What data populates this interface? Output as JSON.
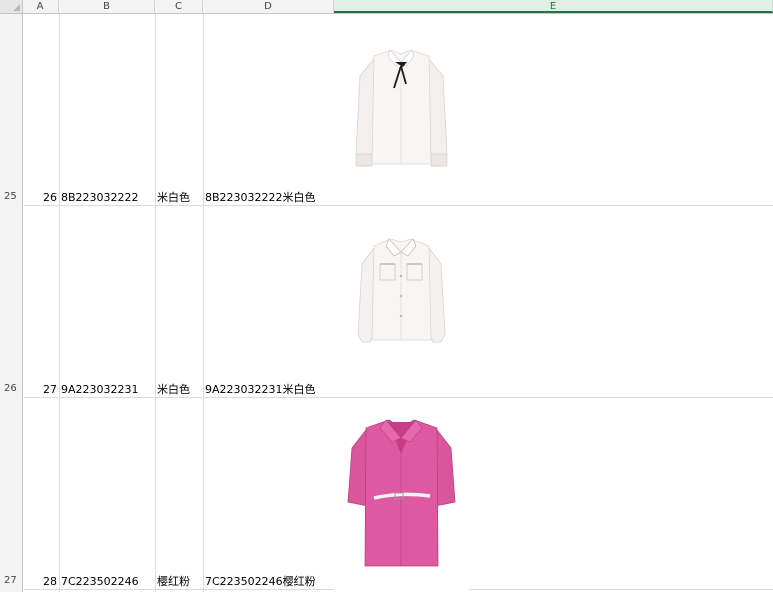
{
  "columns": [
    "A",
    "B",
    "C",
    "D",
    "E"
  ],
  "rows": [
    {
      "row_label": "25",
      "a": "26",
      "b": "8B223032222",
      "c": "米白色",
      "d": "8B223032222米白色",
      "image": "white-blouse-with-black-bow"
    },
    {
      "row_label": "26",
      "a": "27",
      "b": "9A223032231",
      "c": "米白色",
      "d": "9A223032231米白色",
      "image": "white-shirt-with-pockets"
    },
    {
      "row_label": "27",
      "a": "28",
      "b": "7C223502246",
      "c": "樱红粉",
      "d": "7C223502246樱红粉",
      "image": "pink-belted-shirt-dress"
    }
  ],
  "colors": {
    "selected_column": "#217346",
    "pink_garment": "#d9559c",
    "white_garment": "#f7f4f2"
  }
}
